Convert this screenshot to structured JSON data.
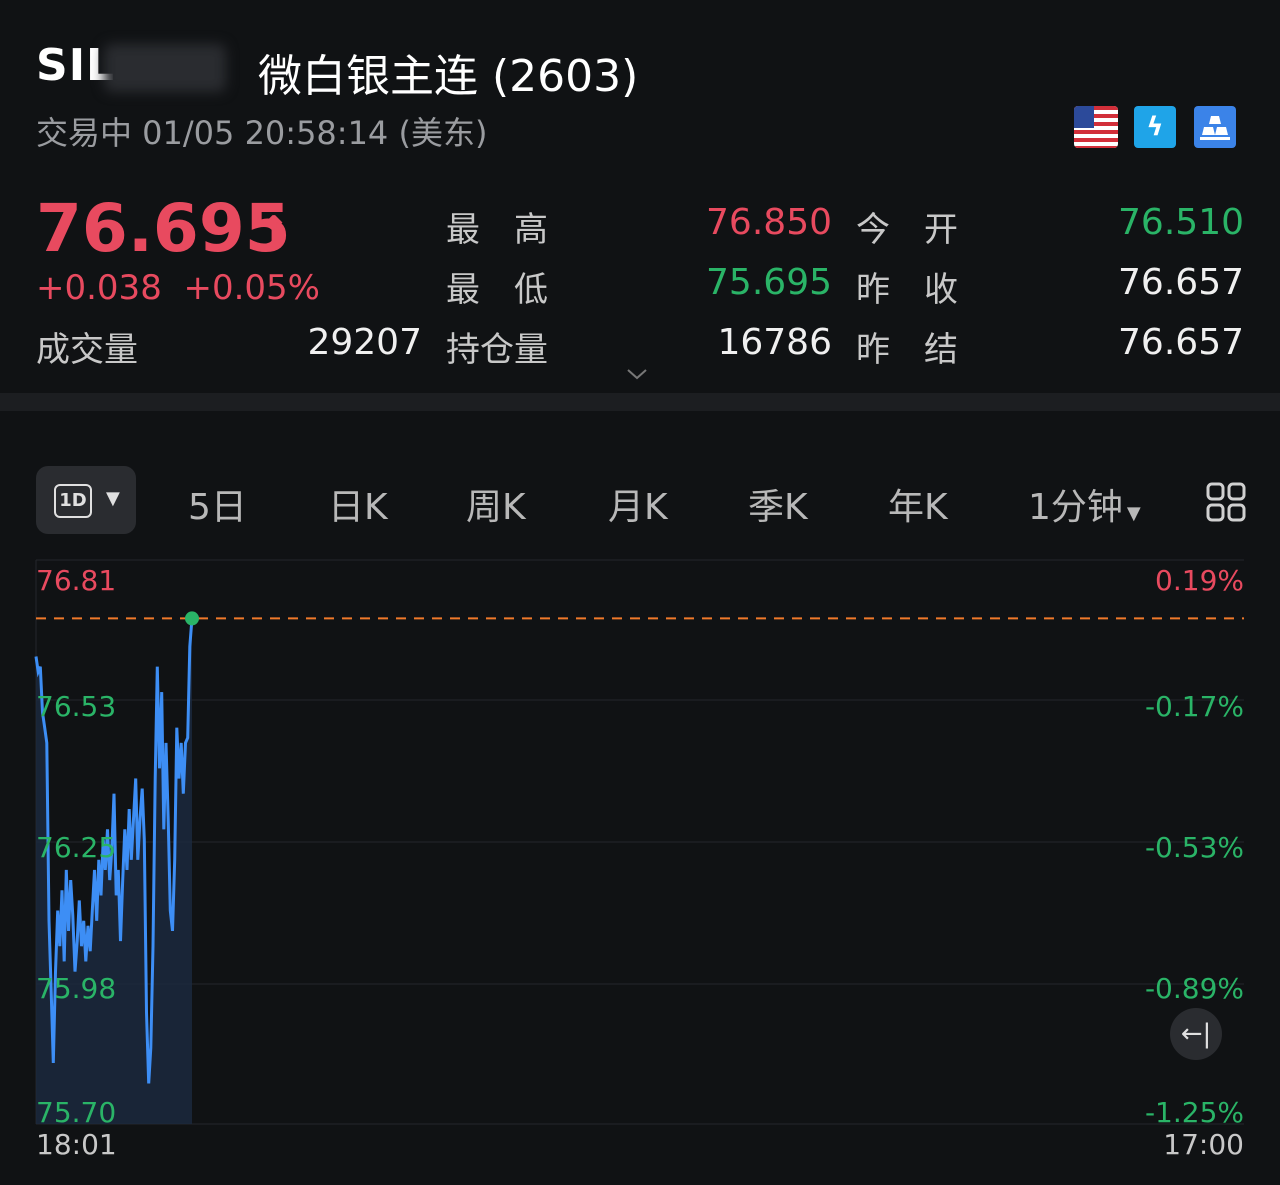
{
  "header": {
    "ticker": "SIL",
    "name": "微白银主连 (2603)",
    "status": "交易中 01/05 20:58:14 (美东)"
  },
  "icons": [
    "us-flag-icon",
    "lightning-icon",
    "gold-bars-icon"
  ],
  "quote": {
    "price": "76.695",
    "arrow": "↑",
    "change": "+0.038",
    "change_pct": "+0.05%",
    "high_label": "最　高",
    "high": "76.850",
    "low_label": "最　低",
    "low": "75.695",
    "open_label": "今　开",
    "open": "76.510",
    "prev_close_label": "昨　收",
    "prev_close": "76.657",
    "prev_settle_label": "昨　结",
    "prev_settle": "76.657",
    "volume_label": "成交量",
    "volume": "29207",
    "oi_label": "持仓量",
    "oi": "16786"
  },
  "tabs": {
    "active": "1D",
    "items": [
      "5日",
      "日K",
      "周K",
      "月K",
      "季K",
      "年K"
    ],
    "interval": "1分钟"
  },
  "colors": {
    "up": "#e84a5f",
    "down": "#2ab467",
    "line": "#3d8ef5",
    "ref": "#f07a2a"
  },
  "chart_data": {
    "type": "line",
    "y_ticks": [
      "76.81",
      "76.53",
      "76.25",
      "75.98",
      "75.70"
    ],
    "pct_ticks": [
      "0.19%",
      "-0.17%",
      "-0.53%",
      "-0.89%",
      "-1.25%"
    ],
    "ylim": [
      75.7,
      76.81
    ],
    "x_start": "18:01",
    "x_end": "17:00",
    "reference_line": 76.695,
    "values": [
      76.62,
      76.59,
      76.6,
      76.51,
      76.48,
      76.45,
      76.1,
      75.96,
      75.82,
      76.0,
      76.12,
      76.05,
      76.16,
      76.02,
      76.2,
      76.08,
      76.18,
      76.11,
      76.0,
      76.06,
      76.14,
      76.05,
      76.1,
      76.02,
      76.09,
      76.04,
      76.12,
      76.2,
      76.1,
      76.22,
      76.15,
      76.26,
      76.2,
      76.28,
      76.18,
      76.24,
      76.35,
      76.15,
      76.2,
      76.06,
      76.18,
      76.28,
      76.2,
      76.32,
      76.22,
      76.3,
      76.38,
      76.22,
      76.3,
      76.36,
      76.26,
      75.92,
      75.78,
      75.85,
      76.05,
      76.38,
      76.6,
      76.4,
      76.55,
      76.28,
      76.45,
      76.3,
      76.12,
      76.08,
      76.22,
      76.48,
      76.38,
      76.45,
      76.35,
      76.45,
      76.46,
      76.64,
      76.695
    ]
  }
}
